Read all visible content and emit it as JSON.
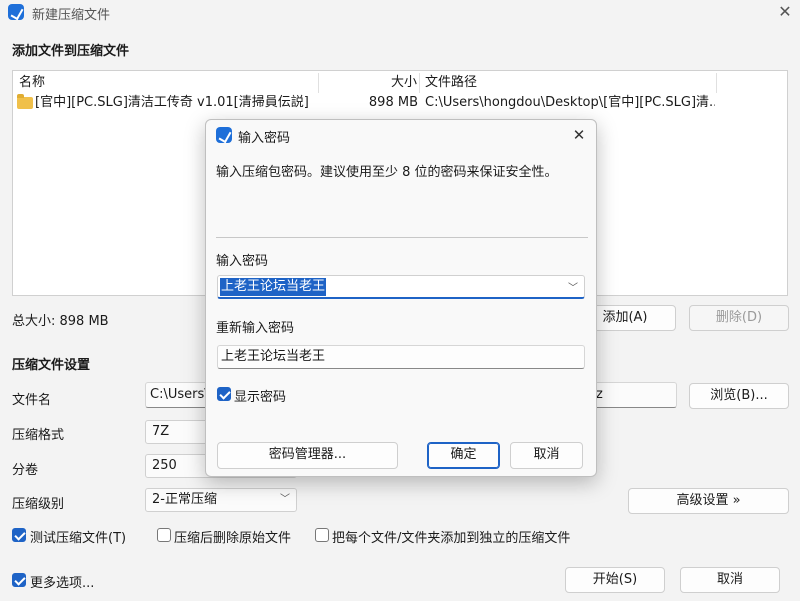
{
  "window": {
    "title": "新建压缩文件",
    "close_glyph": "✕"
  },
  "add_section": {
    "title": "添加文件到压缩文件"
  },
  "file_list": {
    "columns": [
      "名称",
      "大小",
      "文件路径"
    ],
    "rows": [
      {
        "name": "[官中][PC.SLG]清洁工传奇 v1.01[清掃員伝説]",
        "size": "898 MB",
        "path": "C:\\Users\\hongdou\\Desktop\\[官中][PC.SLG]清..."
      }
    ]
  },
  "total_size": "总大小: 898 MB",
  "add_button": "添加(A)",
  "delete_button": "删除(D)",
  "settings": {
    "title": "压缩文件设置",
    "filename_label": "文件名",
    "filename_value": "C:\\Users\\",
    "filename_tail": "z",
    "browse_button": "浏览(B)...",
    "format_label": "压缩格式",
    "format_value": "7Z",
    "volume_label": "分卷",
    "volume_value": "250",
    "level_label": "压缩级别",
    "level_value": "2-正常压缩",
    "advanced_button": "高级设置 »"
  },
  "options": {
    "test": "测试压缩文件(T)",
    "delete_after": "压缩后删除原始文件",
    "separate": "把每个文件/文件夹添加到独立的压缩文件"
  },
  "more_options": "更多选项...",
  "start_button": "开始(S)",
  "cancel_button": "取消",
  "dialog": {
    "title": "输入密码",
    "close_glyph": "✕",
    "description": "输入压缩包密码。建议使用至少 8 位的密码来保证安全性。",
    "password_label": "输入密码",
    "password_value": "上老王论坛当老王",
    "reenter_label": "重新输入密码",
    "reenter_value": "上老王论坛当老王",
    "show_password": "显示密码",
    "manager_button": "密码管理器...",
    "ok_button": "确定",
    "cancel_button": "取消"
  },
  "colors": {
    "accent": "#1e63c6",
    "folder": "#f0c04a"
  }
}
